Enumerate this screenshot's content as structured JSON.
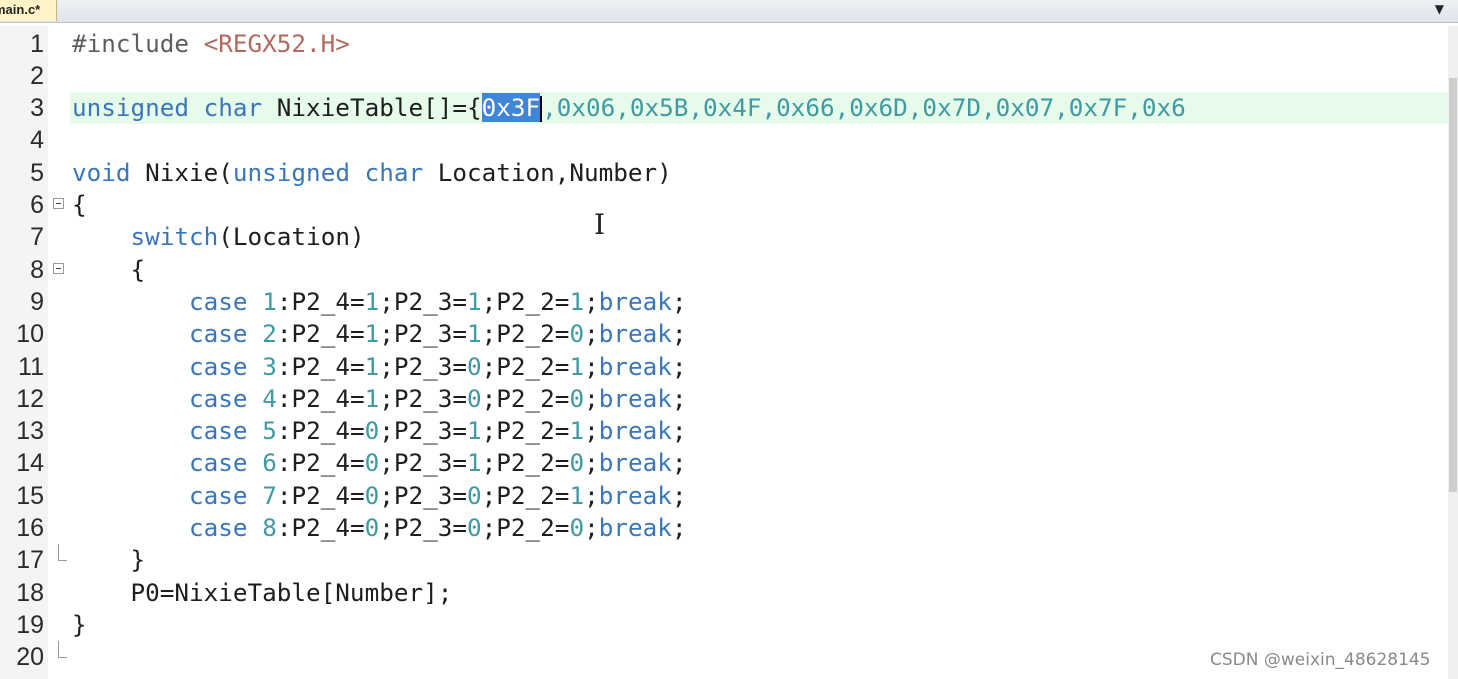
{
  "tab": {
    "label": "main.c*",
    "dropdown_icon": "chevron-down-icon"
  },
  "editor": {
    "lines": [
      {
        "n": "1"
      },
      {
        "n": "2"
      },
      {
        "n": "3"
      },
      {
        "n": "4"
      },
      {
        "n": "5"
      },
      {
        "n": "6"
      },
      {
        "n": "7"
      },
      {
        "n": "8"
      },
      {
        "n": "9"
      },
      {
        "n": "10"
      },
      {
        "n": "11"
      },
      {
        "n": "12"
      },
      {
        "n": "13"
      },
      {
        "n": "14"
      },
      {
        "n": "15"
      },
      {
        "n": "16"
      },
      {
        "n": "17"
      },
      {
        "n": "18"
      },
      {
        "n": "19"
      },
      {
        "n": "20"
      }
    ],
    "code": {
      "l1_directive": "#include",
      "l1_header": " <REGX52.H>",
      "l3_type": "unsigned char",
      "l3_name": " NixieTable[]={",
      "l3_selected": "0x3F",
      "l3_rest_vals": ",0x06,0x5B,0x4F,0x66,0x6D,0x7D,0x07,0x7F,0x6",
      "l5_void": "void",
      "l5_fn": " Nixie(",
      "l5_type": "unsigned char",
      "l5_params": " Location,Number)",
      "l6": "{",
      "l7_switch": "switch",
      "l7_rest": "(Location)",
      "l8": "{",
      "l17": "}",
      "l18": "P0=NixieTable[Number];",
      "l19": "}",
      "cases": [
        {
          "num": "1",
          "a": "1",
          "b": "1",
          "c": "1"
        },
        {
          "num": "2",
          "a": "1",
          "b": "1",
          "c": "0"
        },
        {
          "num": "3",
          "a": "1",
          "b": "0",
          "c": "1"
        },
        {
          "num": "4",
          "a": "1",
          "b": "0",
          "c": "0"
        },
        {
          "num": "5",
          "a": "0",
          "b": "1",
          "c": "1"
        },
        {
          "num": "6",
          "a": "0",
          "b": "1",
          "c": "0"
        },
        {
          "num": "7",
          "a": "0",
          "b": "0",
          "c": "1"
        },
        {
          "num": "8",
          "a": "0",
          "b": "0",
          "c": "0"
        }
      ],
      "kw_case": "case",
      "kw_break": "break",
      "p24": ":P2_4=",
      "p23": ";P2_3=",
      "p22": ";P2_2=",
      "semi": ";",
      "semi_end": ";"
    }
  },
  "watermark": "CSDN @weixin_48628145"
}
